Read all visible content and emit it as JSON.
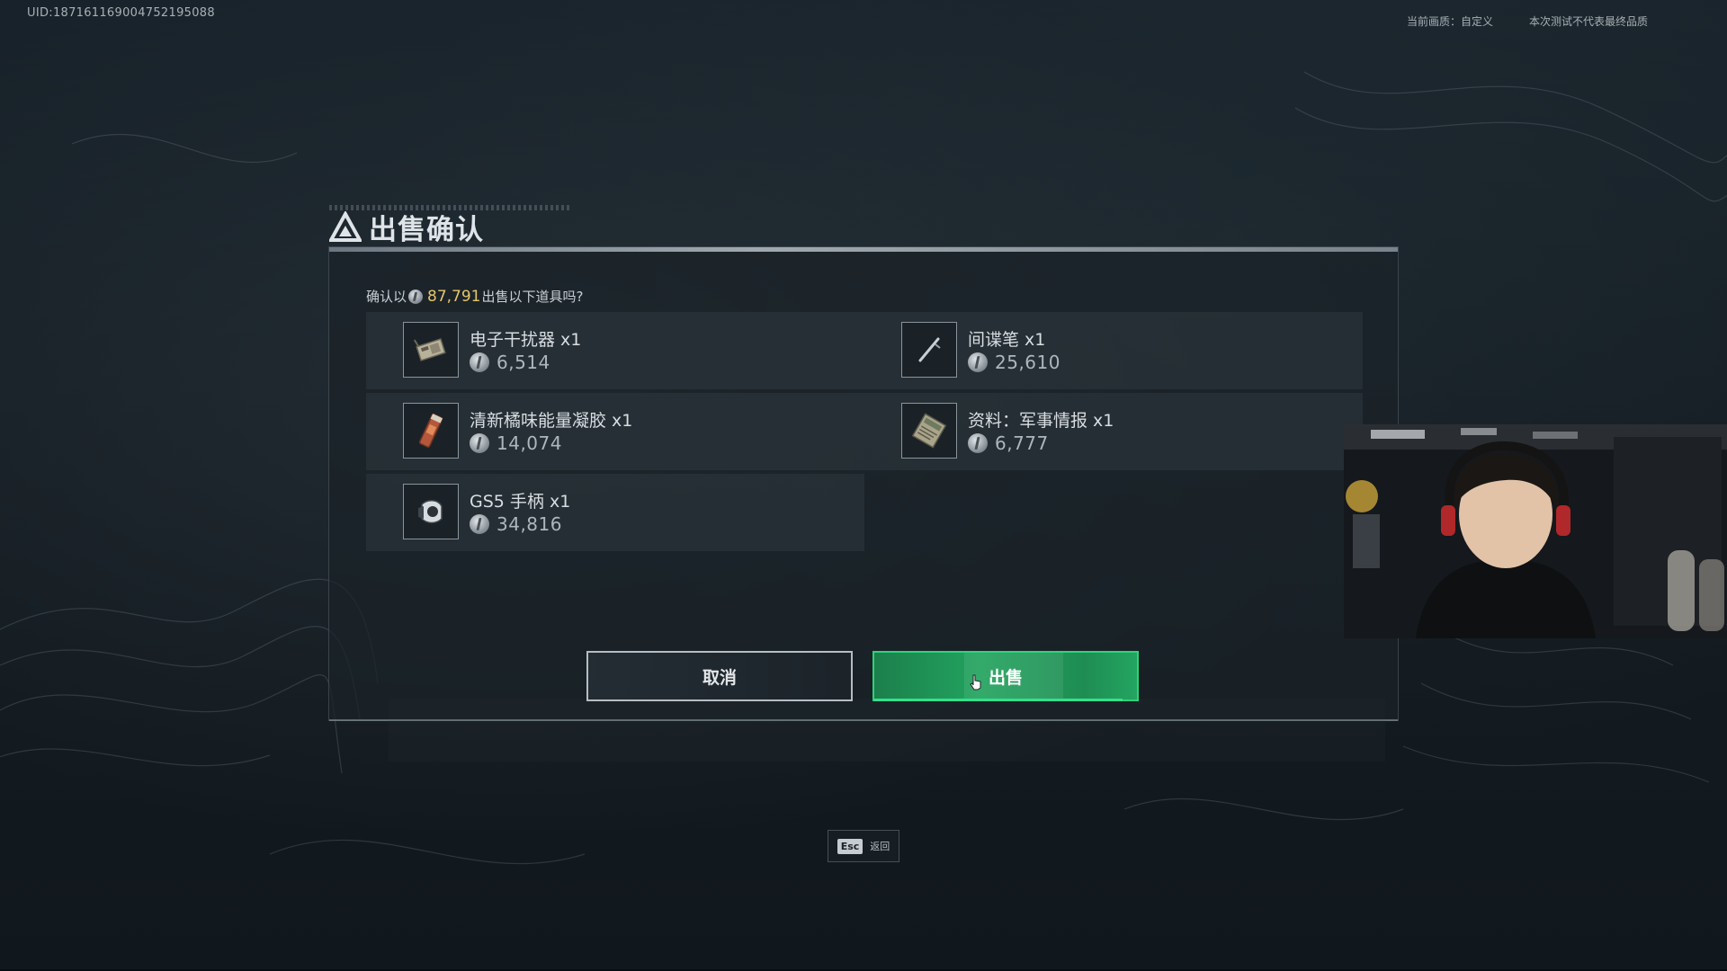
{
  "hud": {
    "uid": "UID:187161169004752195088",
    "quality_label": "当前画质：",
    "quality_value": "自定义",
    "test_notice": "本次测试不代表最终品质"
  },
  "dialog": {
    "title": "出售确认",
    "confirm_prefix": "确认以",
    "total_price": "87,791",
    "confirm_suffix": "出售以下道具吗?",
    "items": [
      {
        "name": "电子干扰器 x1",
        "price": "6,514",
        "icon": "jammer-icon"
      },
      {
        "name": "间谍笔 x1",
        "price": "25,610",
        "icon": "spy-pen-icon"
      },
      {
        "name": "清新橘味能量凝胶 x1",
        "price": "14,074",
        "icon": "energy-gel-icon"
      },
      {
        "name": "资料：军事情报 x1",
        "price": "6,777",
        "icon": "intel-document-icon"
      },
      {
        "name": "GS5 手柄 x1",
        "price": "34,816",
        "icon": "gamepad-icon"
      }
    ],
    "cancel_label": "取消",
    "sell_label": "出售"
  },
  "esc_hint": {
    "key": "Esc",
    "label": "返回"
  },
  "colors": {
    "price_gold": "#e5c66a",
    "sell_green": "#22a35e",
    "sell_border": "#2fd27a"
  }
}
